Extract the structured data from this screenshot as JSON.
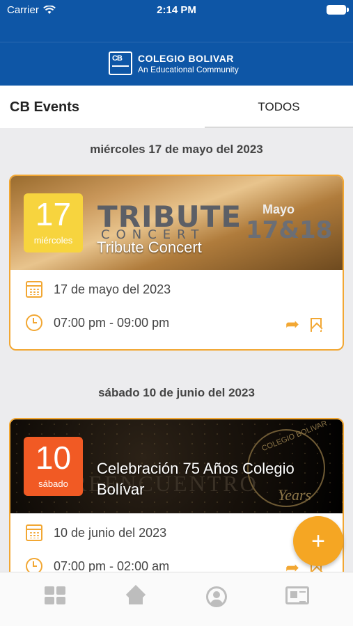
{
  "status_bar": {
    "carrier": "Carrier",
    "time": "2:14 PM"
  },
  "header": {
    "logo_name": "COLEGIO BOLIVAR",
    "logo_tagline": "An Educational Community",
    "logo_mark": "CB"
  },
  "titlebar": {
    "title": "CB Events",
    "tab": "TODOS"
  },
  "events": [
    {
      "heading": "miércoles 17 de mayo del 2023",
      "day_num": "17",
      "day_name": "miércoles",
      "badge_color": "#f7d43e",
      "title": "Tribute Concert",
      "image_text": {
        "main": "TRIBUTE",
        "sub": "CONCERT",
        "month": "Mayo",
        "dates": "17&18"
      },
      "date": "17 de mayo del 2023",
      "time": "07:00 pm - 09:00 pm"
    },
    {
      "heading": "sábado 10 de junio del 2023",
      "day_num": "10",
      "day_name": "sábado",
      "badge_color": "#f15a24",
      "title": "Celebración 75 Años Colegio Bolívar",
      "image_text": {
        "main": "REENCUENTRO",
        "seal": "COLEGIO BOLIVAR",
        "years": "Years"
      },
      "date": "10 de junio del 2023",
      "time": "07:00 pm - 02:00 am"
    }
  ],
  "fab": {
    "label": "+"
  },
  "bottom_nav": [
    "grid-icon",
    "home-icon",
    "profile-icon",
    "news-icon"
  ],
  "colors": {
    "primary": "#0e56a6",
    "accent": "#f2a733",
    "fab": "#f5a623"
  }
}
